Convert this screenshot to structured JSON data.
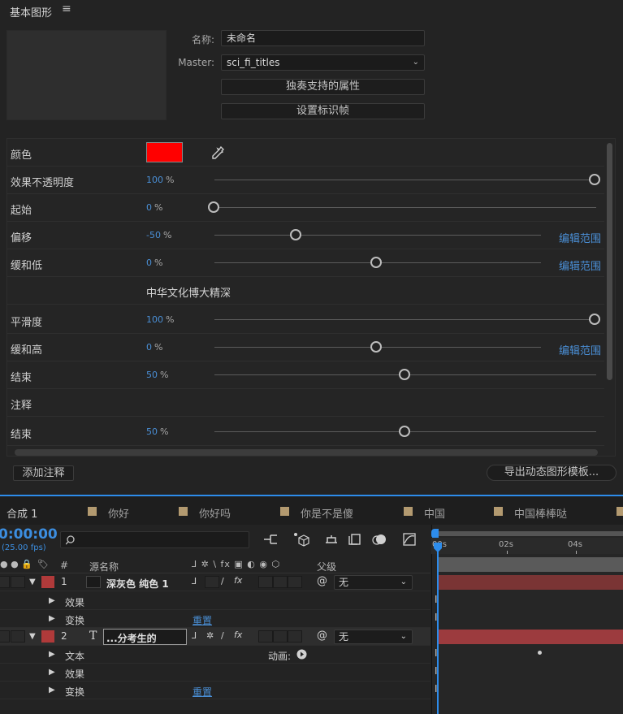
{
  "panel": {
    "title": "基本图形",
    "menu_icon": "≡",
    "name_label": "名称:",
    "name_value": "未命名",
    "master_label": "Master:",
    "master_value": "sci_fi_titles",
    "solo_button": "独奏支持的属性",
    "keyframe_button": "设置标识帧",
    "add_comment_button": "添加注释",
    "export_button": "导出动态图形模板...",
    "properties": [
      {
        "name": "颜色",
        "type": "color",
        "color": "#ff0000"
      },
      {
        "name": "效果不透明度",
        "value": "100",
        "unit": "%",
        "slider": 1.0
      },
      {
        "name": "起始",
        "value": "0",
        "unit": "%",
        "slider": 0.0
      },
      {
        "name": "偏移",
        "value": "-50",
        "unit": "%",
        "slider": 0.25,
        "link": "编辑范围"
      },
      {
        "name": "缓和低",
        "value": "0",
        "unit": "%",
        "slider": 0.5,
        "link": "编辑范围"
      },
      {
        "name": "",
        "type": "group",
        "text": "中华文化博大精深"
      },
      {
        "name": "平滑度",
        "value": "100",
        "unit": "%",
        "slider": 1.0
      },
      {
        "name": "缓和高",
        "value": "0",
        "unit": "%",
        "slider": 0.5,
        "link": "编辑范围"
      },
      {
        "name": "结束",
        "value": "50",
        "unit": "%",
        "slider": 0.5
      },
      {
        "name": "注释",
        "type": "comment"
      },
      {
        "name": "结束",
        "value": "50",
        "unit": "%",
        "slider": 0.5
      }
    ]
  },
  "timeline": {
    "tabs": [
      {
        "label": "合成 1",
        "active": true
      },
      {
        "label": "你好"
      },
      {
        "label": "你好吗"
      },
      {
        "label": "你是不是傻"
      },
      {
        "label": "中国"
      },
      {
        "label": "中国棒棒哒"
      }
    ],
    "timecode": "0:00:00",
    "fps": "(25.00 fps)",
    "header": {
      "number": "#",
      "source_name": "源名称",
      "parent": "父级"
    },
    "ruler": [
      "00s",
      "02s",
      "04s"
    ],
    "layers": [
      {
        "number": "1",
        "name": "深灰色 纯色 1",
        "color": "#b03a3a",
        "parent": "无",
        "type": "solid"
      },
      {
        "number": "2",
        "name": "...分考生的",
        "color": "#b03a3a",
        "parent": "无",
        "type": "text"
      }
    ],
    "layer1_children": [
      {
        "label": "效果"
      },
      {
        "label": "变换",
        "reset": "重置"
      }
    ],
    "layer2_children": [
      {
        "label": "文本",
        "animate": "动画:"
      },
      {
        "label": "效果"
      },
      {
        "label": "变换",
        "reset": "重置"
      }
    ],
    "text_layer_icon": "T"
  }
}
